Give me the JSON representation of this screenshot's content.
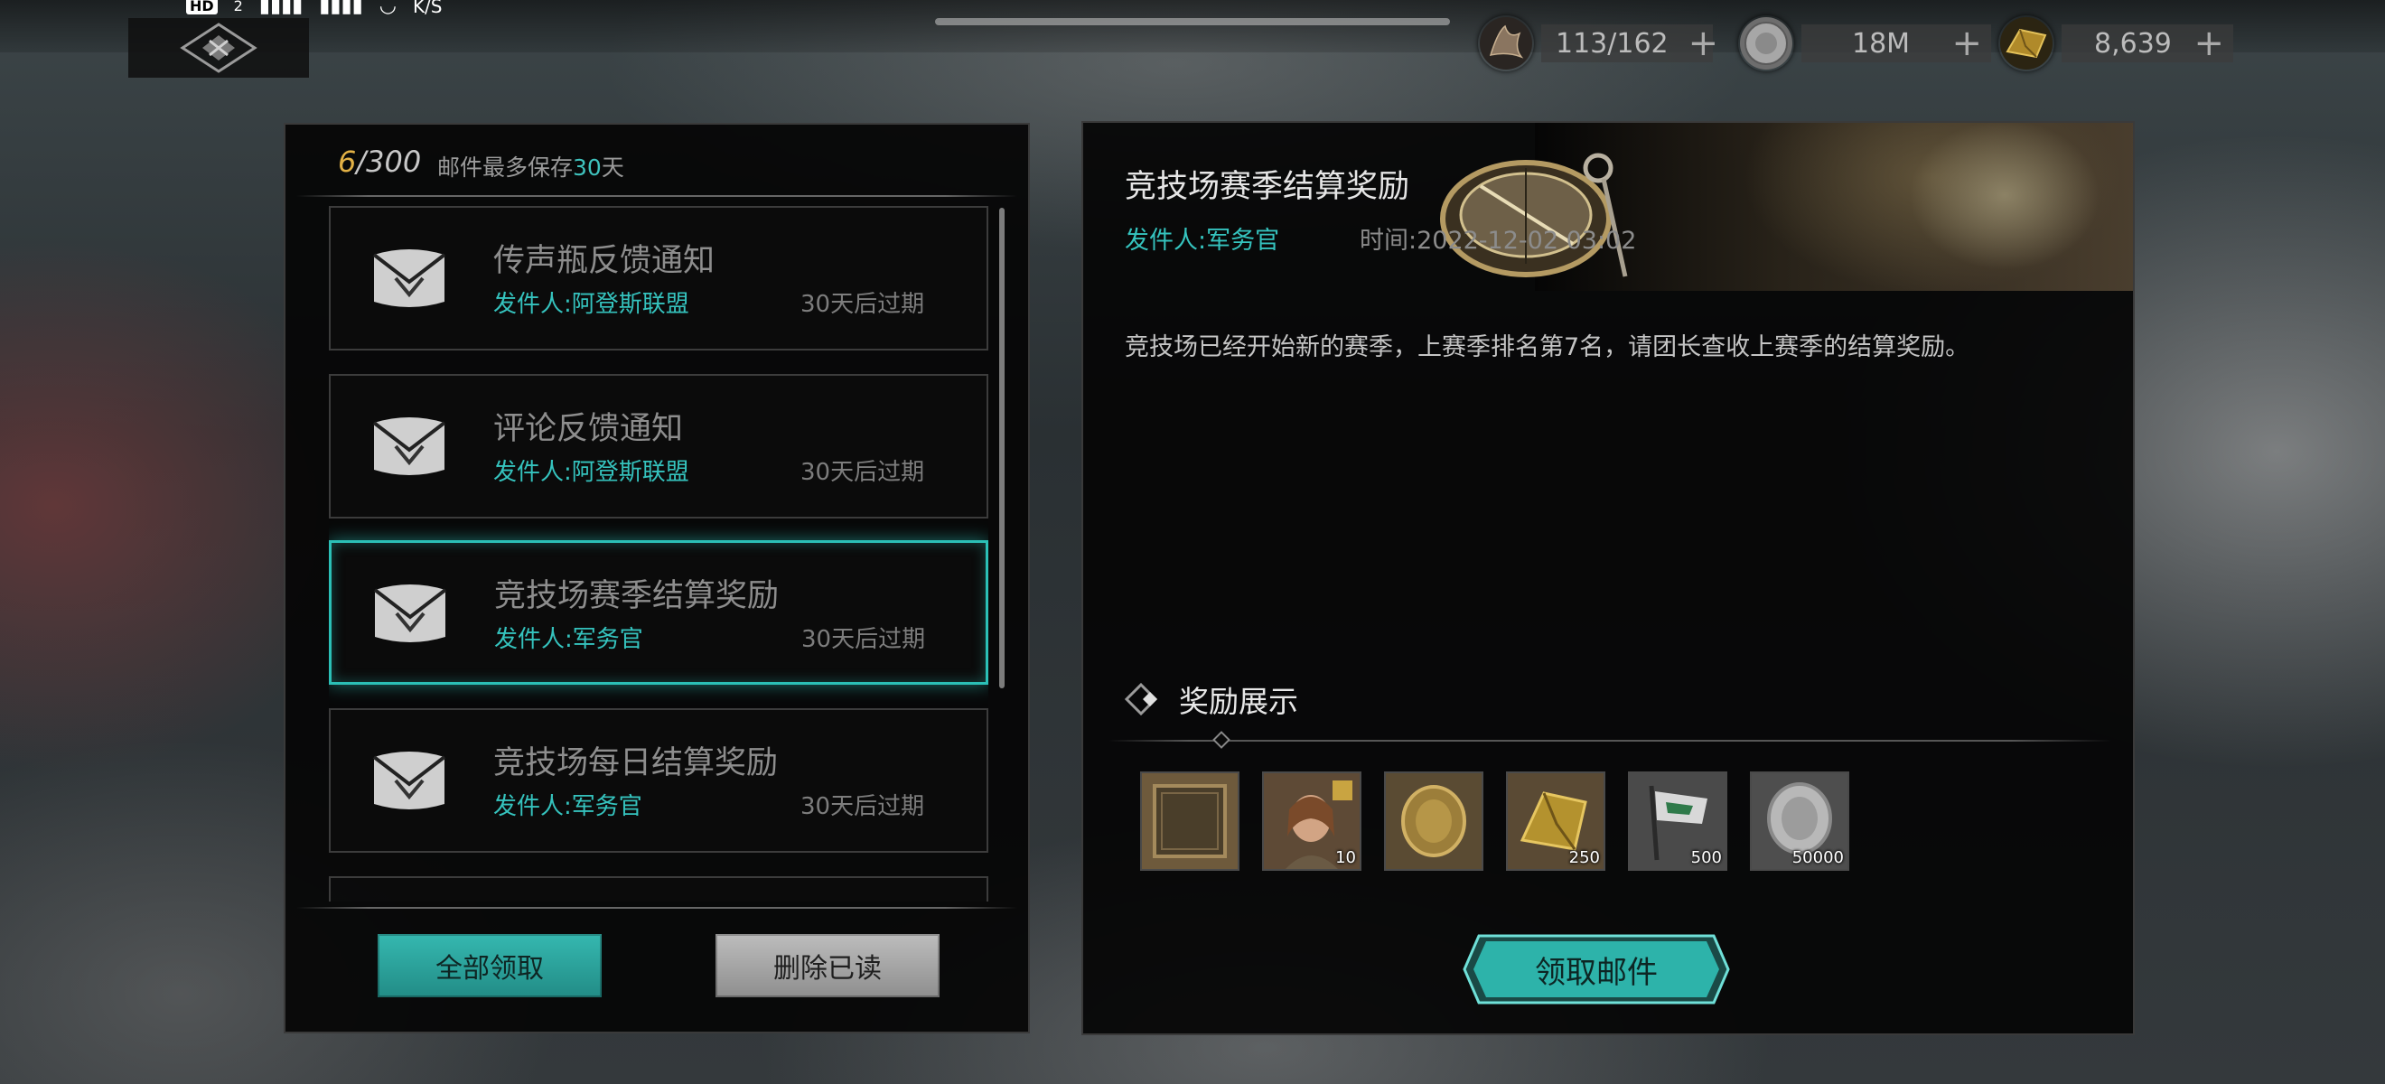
{
  "status_bar": {
    "hd_badge": "HD",
    "sim_number": "2",
    "speed_unit": "K/S"
  },
  "resources": [
    {
      "name": "troops",
      "value": "113/162",
      "icon": "troop-claw-icon",
      "color": "#7a6a5a"
    },
    {
      "name": "silver",
      "value": "18M",
      "icon": "silver-coin-icon",
      "color": "#9a9a9a"
    },
    {
      "name": "gold",
      "value": "8,639",
      "icon": "gold-ingot-icon",
      "color": "#b08a2a"
    }
  ],
  "mail_panel": {
    "count_current": "6",
    "count_max": "/300",
    "retention_prefix": "邮件最多保存",
    "retention_days": "30",
    "retention_suffix": "天",
    "items": [
      {
        "title": "传声瓶反馈通知",
        "sender": "发件人:阿登斯联盟",
        "expiry": "30天后过期",
        "selected": false
      },
      {
        "title": "评论反馈通知",
        "sender": "发件人:阿登斯联盟",
        "expiry": "30天后过期",
        "selected": false
      },
      {
        "title": "竞技场赛季结算奖励",
        "sender": "发件人:军务官",
        "expiry": "30天后过期",
        "selected": true
      },
      {
        "title": "竞技场每日结算奖励",
        "sender": "发件人:军务官",
        "expiry": "30天后过期",
        "selected": false
      }
    ],
    "claim_all_label": "全部领取",
    "delete_read_label": "删除已读"
  },
  "mail_detail": {
    "title": "竞技场赛季结算奖励",
    "sender": "发件人:军务官",
    "time": "时间:2022-12-02 03:02",
    "body": "竞技场已经开始新的赛季，上赛季排名第7名，请团长查收上赛季的结算奖励。",
    "rewards_title": "奖励展示",
    "rewards": [
      {
        "icon": "avatar-frame-icon",
        "quantity": ""
      },
      {
        "icon": "hero-portrait-icon",
        "quantity": "10"
      },
      {
        "icon": "gold-medal-icon",
        "quantity": ""
      },
      {
        "icon": "gold-ore-icon",
        "quantity": "250"
      },
      {
        "icon": "banner-flag-icon",
        "quantity": "500"
      },
      {
        "icon": "silver-coin-icon",
        "quantity": "50000"
      }
    ],
    "claim_label": "领取邮件"
  },
  "colors": {
    "accent_teal": "#35c3be",
    "count_gold": "#e2b145"
  }
}
